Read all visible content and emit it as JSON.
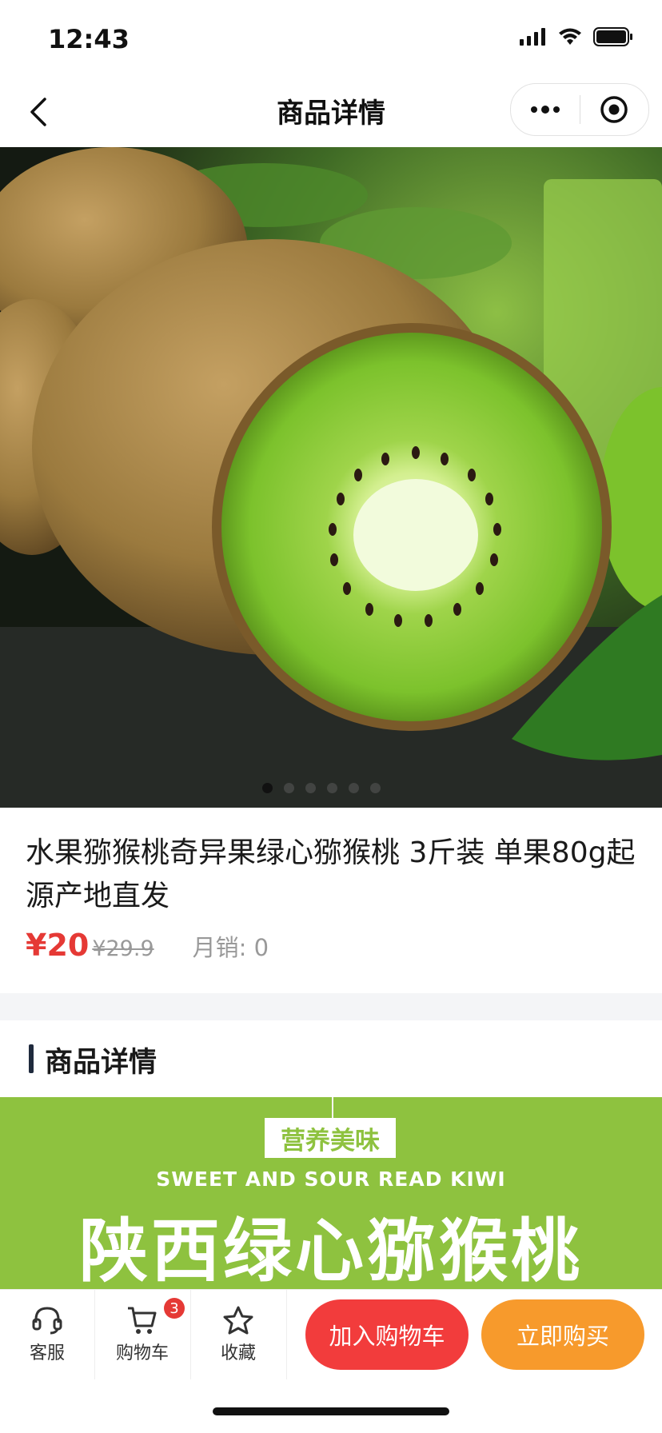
{
  "status_bar": {
    "time": "12:43"
  },
  "nav": {
    "title": "商品详情",
    "more_icon": "more-dots-icon",
    "close_icon": "target-circle-icon"
  },
  "hero": {
    "image_alt": "kiwi fruit photo",
    "slide_count": 6,
    "active_slide": 0
  },
  "product": {
    "title": "水果猕猴桃奇异果绿心猕猴桃 3斤装 单果80g起源产地直发",
    "price": "¥20",
    "original_price": "¥29.9",
    "sales_label": "月销: 0"
  },
  "detail_section": {
    "title": "商品详情"
  },
  "banner": {
    "tag": "营养美味",
    "english": "SWEET AND SOUR READ KIWI",
    "headline": "陕西绿心猕猴桃"
  },
  "bottom_bar": {
    "service_label": "客服",
    "cart_label": "购物车",
    "cart_badge": "3",
    "favorite_label": "收藏",
    "add_to_cart_label": "加入购物车",
    "buy_now_label": "立即购买"
  },
  "colors": {
    "price_red": "#e53935",
    "add_cart_red": "#f23c3c",
    "buy_orange": "#f79a2c",
    "banner_green": "#8ec23f"
  }
}
